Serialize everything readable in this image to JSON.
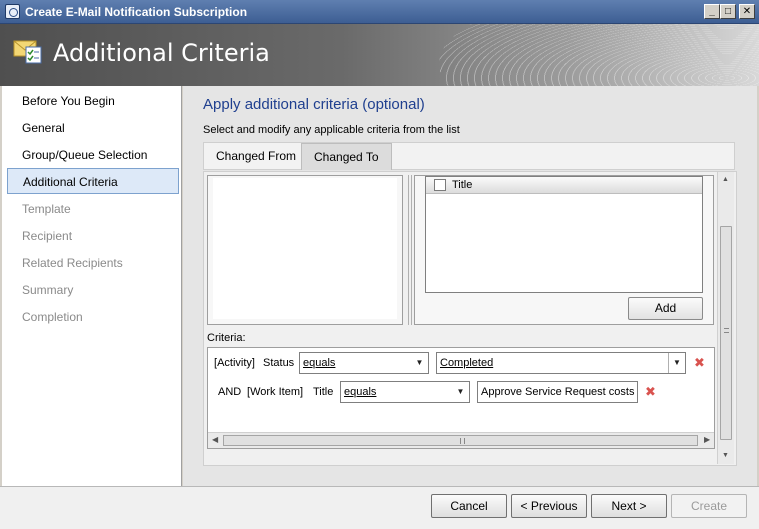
{
  "window": {
    "title": "Create E-Mail Notification Subscription",
    "controls": {
      "minimize": "_",
      "maximize": "□",
      "close": "✕"
    }
  },
  "header": {
    "title": "Additional Criteria",
    "icon": "mail-checklist-icon"
  },
  "nav": {
    "items": [
      {
        "label": "Before You Begin",
        "state": "normal"
      },
      {
        "label": "General",
        "state": "normal"
      },
      {
        "label": "Group/Queue Selection",
        "state": "normal"
      },
      {
        "label": "Additional Criteria",
        "state": "active"
      },
      {
        "label": "Template",
        "state": "disabled"
      },
      {
        "label": "Recipient",
        "state": "disabled"
      },
      {
        "label": "Related Recipients",
        "state": "disabled"
      },
      {
        "label": "Summary",
        "state": "disabled"
      },
      {
        "label": "Completion",
        "state": "disabled"
      }
    ]
  },
  "main": {
    "heading": "Apply additional criteria (optional)",
    "description": "Select and modify any applicable criteria from the list",
    "tabs": [
      {
        "label": "Changed From",
        "selected": false
      },
      {
        "label": "Changed To",
        "selected": true
      }
    ],
    "property_list": {
      "items": [
        {
          "label": "Title",
          "checked": false
        }
      ]
    },
    "add_button": "Add",
    "criteria_label": "Criteria:",
    "criteria": [
      {
        "prefix": "",
        "class_label": "Activity",
        "property": "Status",
        "operator": "equals",
        "value": "Completed"
      },
      {
        "prefix": "AND",
        "class_label": "Work Item",
        "property": "Title",
        "operator": "equals",
        "value": "Approve Service Request costs"
      }
    ]
  },
  "footer": {
    "cancel": "Cancel",
    "previous": "< Previous",
    "next": "Next >",
    "create": "Create"
  },
  "colors": {
    "accent": "#1f3f8f",
    "active_nav_bg": "#dde9f8",
    "remove": "#d9534f"
  }
}
